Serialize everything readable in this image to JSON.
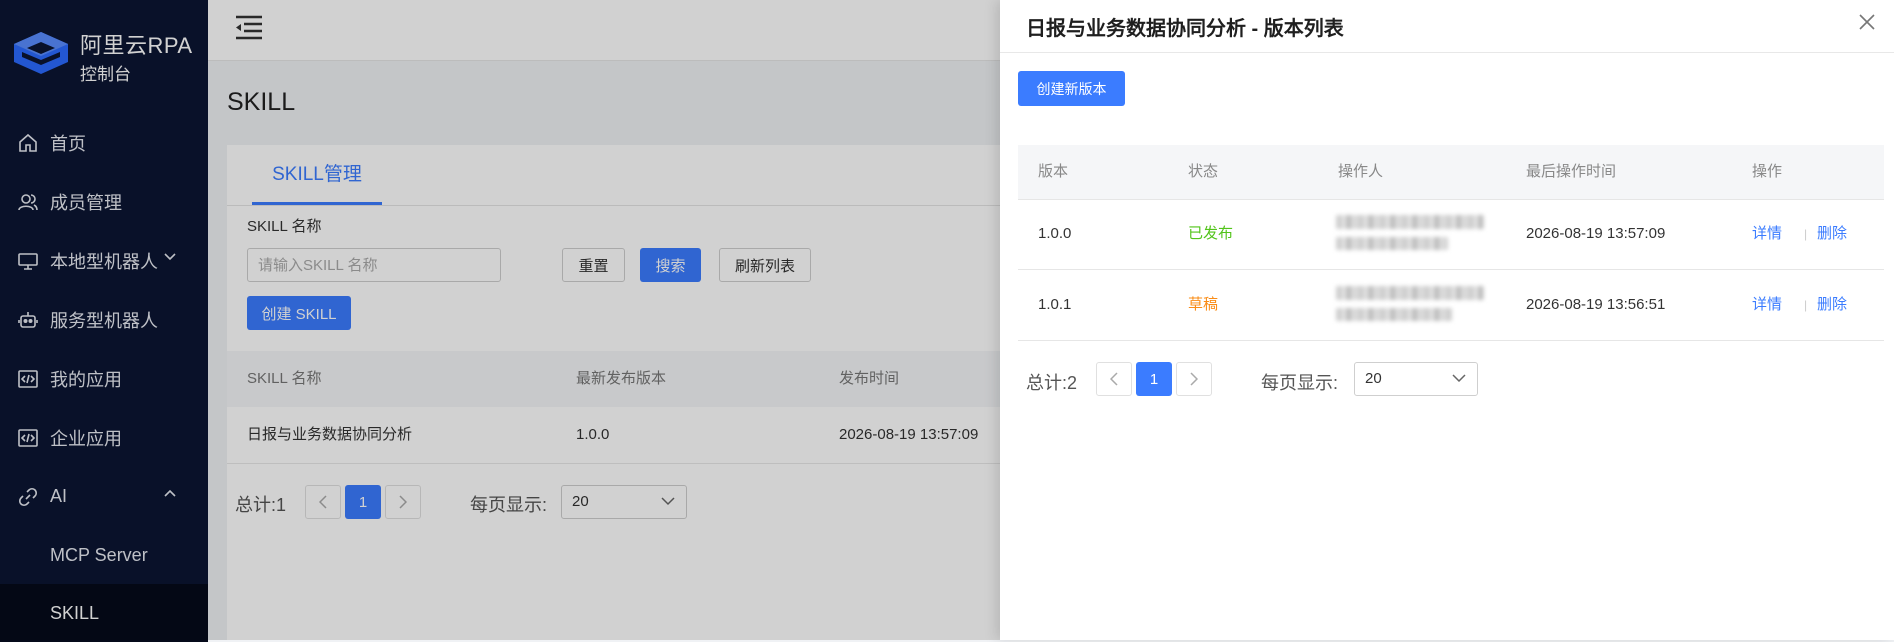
{
  "sidebar": {
    "brand_title": "阿里云RPA",
    "brand_subtitle": "控制台",
    "items": [
      {
        "label": "首页",
        "icon": "home-icon"
      },
      {
        "label": "成员管理",
        "icon": "members-icon"
      },
      {
        "label": "本地型机器人",
        "icon": "monitor-icon",
        "expandable": true,
        "expanded": false
      },
      {
        "label": "服务型机器人",
        "icon": "robot-icon"
      },
      {
        "label": "我的应用",
        "icon": "code-icon"
      },
      {
        "label": "企业应用",
        "icon": "code-icon"
      },
      {
        "label": "AI",
        "icon": "link-icon",
        "expandable": true,
        "expanded": true
      }
    ],
    "sub_items": [
      {
        "label": "MCP Server",
        "active": false
      },
      {
        "label": "SKILL",
        "active": true
      }
    ]
  },
  "main": {
    "page_title": "SKILL",
    "tab_label": "SKILL管理",
    "filter_label": "SKILL 名称",
    "search_placeholder": "请输入SKILL 名称",
    "buttons": {
      "reset": "重置",
      "search": "搜索",
      "refresh": "刷新列表",
      "create": "创建 SKILL"
    },
    "table": {
      "columns": [
        "SKILL 名称",
        "最新发布版本",
        "发布时间"
      ],
      "rows": [
        {
          "name": "日报与业务数据协同分析",
          "version": "1.0.0",
          "time": "2026-08-19 13:57:09"
        }
      ]
    },
    "pagination": {
      "total_label": "总计:1",
      "current_page": "1",
      "page_size_label": "每页显示:",
      "page_size": "20"
    }
  },
  "drawer": {
    "title": "日报与业务数据协同分析 - 版本列表",
    "create_button": "创建新版本",
    "columns": [
      "版本",
      "状态",
      "操作人",
      "最后操作时间",
      "操作"
    ],
    "rows": [
      {
        "version": "1.0.0",
        "status": "已发布",
        "status_color": "#52c41a",
        "time": "2026-08-19 13:57:09",
        "action_detail": "详情",
        "action_delete": "删除"
      },
      {
        "version": "1.0.1",
        "status": "草稿",
        "status_color": "#fa8c16",
        "time": "2026-08-19 13:56:51",
        "action_detail": "详情",
        "action_delete": "删除"
      }
    ],
    "pagination": {
      "total_label": "总计:2",
      "current_page": "1",
      "page_size_label": "每页显示:",
      "page_size": "20"
    }
  },
  "colors": {
    "sidebar_bg": "#0b1533",
    "primary": "#3b7cff",
    "published": "#52c41a",
    "draft": "#fa8c16"
  }
}
